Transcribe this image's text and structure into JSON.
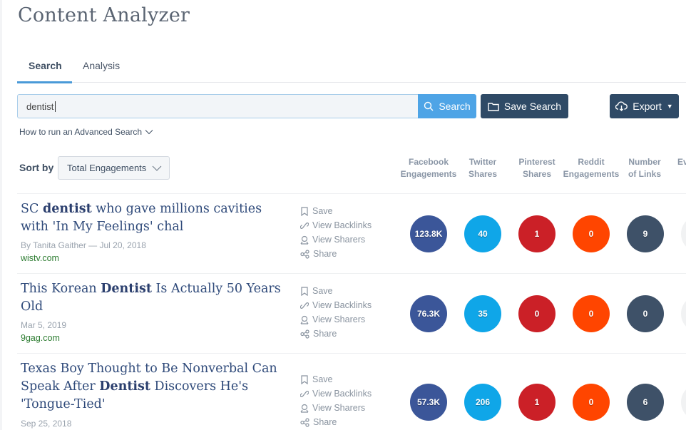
{
  "app": {
    "title": "Content Analyzer"
  },
  "tabs": [
    {
      "label": "Search",
      "active": true
    },
    {
      "label": "Analysis",
      "active": false
    }
  ],
  "search": {
    "value": "dentist",
    "search_label": "Search",
    "save_label": "Save Search",
    "export_label": "Export",
    "advanced_label": "How to run an Advanced Search"
  },
  "sort": {
    "label": "Sort by",
    "selected": "Total Engagements"
  },
  "columns": [
    {
      "line1": "Facebook",
      "line2": "Engagements"
    },
    {
      "line1": "Twitter",
      "line2": "Shares"
    },
    {
      "line1": "Pinterest",
      "line2": "Shares"
    },
    {
      "line1": "Reddit",
      "line2": "Engagements"
    },
    {
      "line1": "Number",
      "line2": "of Links"
    },
    {
      "line1": "Ev",
      "line2": ""
    }
  ],
  "actions": [
    "Save",
    "View Backlinks",
    "View Sharers",
    "Share"
  ],
  "colors": {
    "facebook": "#3b5699",
    "twitter": "#0fa6e8",
    "pinterest": "#cb2027",
    "reddit": "#ff4500",
    "links": "#3e5168",
    "accent": "#4ea4e6",
    "dark_button": "#2f4a66"
  },
  "results": [
    {
      "title_pre": "SC ",
      "title_bold": "dentist",
      "title_post": " who gave millions cavities with 'In My Feelings' chal",
      "meta": "By Tanita Gaither — Jul 20, 2018",
      "domain": "wistv.com",
      "facebook": "123.8K",
      "twitter": "40",
      "pinterest": "1",
      "reddit": "0",
      "links": "9"
    },
    {
      "title_pre": "This Korean ",
      "title_bold": "Dentist",
      "title_post": " Is Actually 50 Years Old",
      "meta": "Mar 5, 2019",
      "domain": "9gag.com",
      "facebook": "76.3K",
      "twitter": "35",
      "pinterest": "0",
      "reddit": "0",
      "links": "0"
    },
    {
      "title_pre": "Texas Boy Thought to Be Nonverbal Can Speak After ",
      "title_bold": "Dentist",
      "title_post": " Discovers He's 'Tongue-Tied'",
      "meta": "Sep 25, 2018",
      "domain": "",
      "facebook": "57.3K",
      "twitter": "206",
      "pinterest": "1",
      "reddit": "0",
      "links": "6"
    }
  ]
}
